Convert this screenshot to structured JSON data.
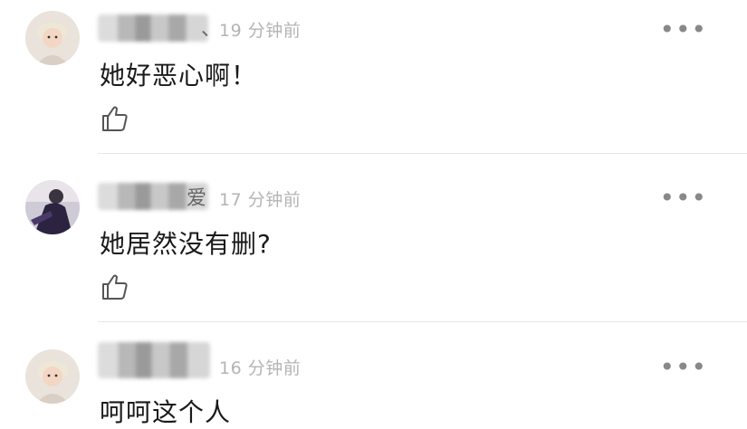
{
  "comments": [
    {
      "name_tail": "、",
      "time": "19 分钟前",
      "text": "她好恶心啊！",
      "avatar": "child-avatar",
      "like_icon": "thumbs-up-icon",
      "more_icon": "more-icon",
      "more": "•••"
    },
    {
      "name_tail": "爱",
      "time": "17 分钟前",
      "text": "她居然没有删?",
      "avatar": "photo-avatar",
      "like_icon": "thumbs-up-icon",
      "more_icon": "more-icon",
      "more": "•••"
    },
    {
      "name_tail": "",
      "time": "16 分钟前",
      "text": "呵呵这个人",
      "avatar": "child-avatar",
      "like_icon": "thumbs-up-icon",
      "more_icon": "more-icon",
      "more": "•••"
    }
  ],
  "colors": {
    "time_text": "#b4b4b4",
    "body_text": "#1a1a1a",
    "divider": "#e6e6e6"
  }
}
